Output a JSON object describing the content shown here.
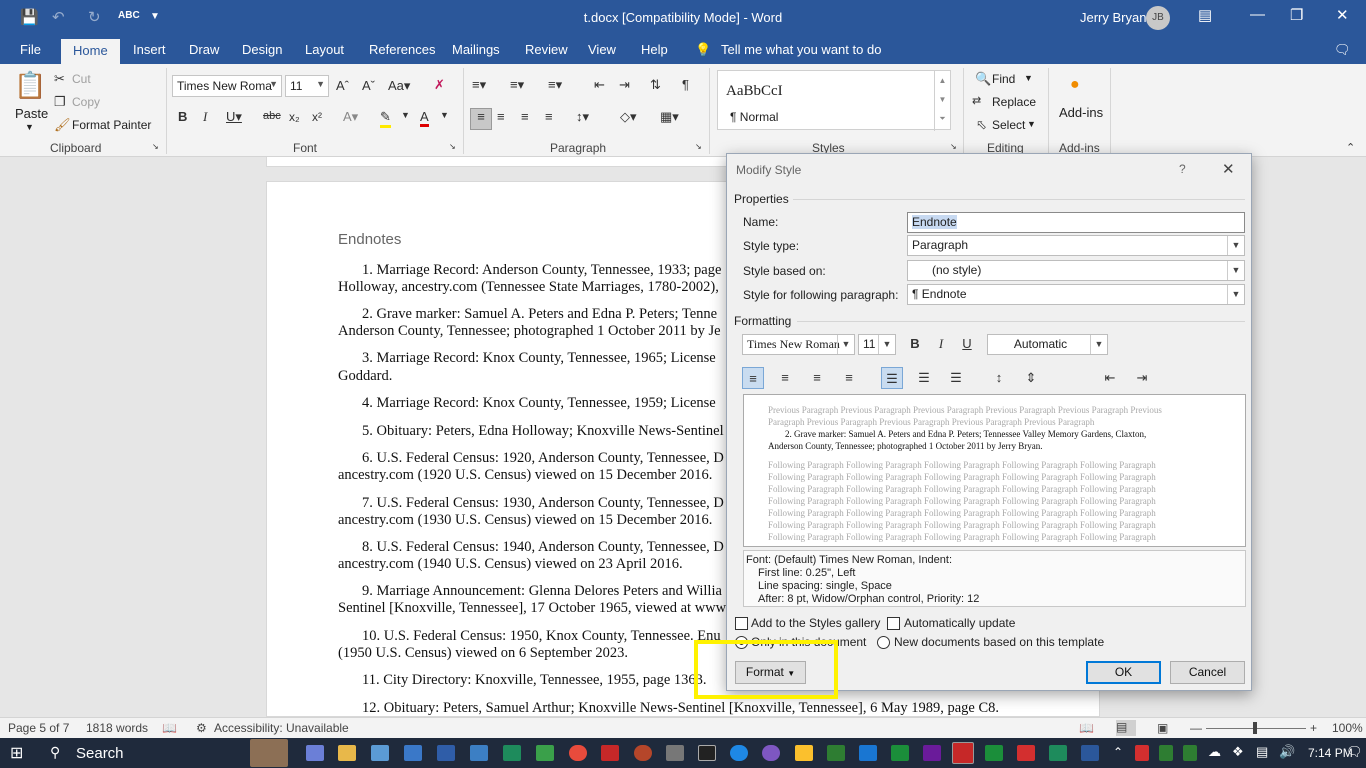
{
  "titlebar": {
    "title": "t.docx [Compatibility Mode]  -  Word",
    "user": "Jerry Bryan",
    "avatar_initials": "JB"
  },
  "tabs": [
    "File",
    "Home",
    "Insert",
    "Draw",
    "Design",
    "Layout",
    "References",
    "Mailings",
    "Review",
    "View",
    "Help"
  ],
  "tell_me": "Tell me what you want to do",
  "ribbon": {
    "clipboard": {
      "paste": "Paste",
      "cut": "Cut",
      "copy": "Copy",
      "format_painter": "Format Painter",
      "label": "Clipboard"
    },
    "font": {
      "name": "Times New Roma",
      "size": "11",
      "label": "Font"
    },
    "paragraph": {
      "label": "Paragraph"
    },
    "styles": {
      "sample": "AaBbCcI",
      "normal": "¶ Normal",
      "label": "Styles"
    },
    "editing": {
      "find": "Find",
      "replace": "Replace",
      "select": "Select",
      "label": "Editing"
    },
    "addins": {
      "button": "Add-ins",
      "label": "Add-ins"
    }
  },
  "document": {
    "heading": "Endnotes",
    "lines": [
      "1. Marriage Record: Anderson County, Tennessee, 1933; page",
      "Holloway, ancestry.com (Tennessee State Marriages, 1780-2002),",
      "2. Grave marker: Samuel A. Peters and Edna P. Peters; Tenne",
      "Anderson County, Tennessee; photographed 1 October 2011 by Je",
      "3. Marriage Record: Knox County, Tennessee, 1965; License",
      "Goddard.",
      "4. Marriage Record: Knox County, Tennessee, 1959; License",
      "5. Obituary: Peters, Edna Holloway; Knoxville News-Sentinel",
      "6. U.S. Federal Census: 1920, Anderson County, Tennessee, D",
      "ancestry.com (1920 U.S. Census) viewed on 15 December 2016.",
      "7. U.S. Federal Census: 1930, Anderson County, Tennessee, D",
      "ancestry.com (1930 U.S. Census) viewed on 15 December 2016.",
      "8. U.S. Federal Census: 1940, Anderson County, Tennessee, D",
      "ancestry.com (1940 U.S. Census) viewed on 23 April 2016.",
      "9. Marriage Announcement: Glenna Delores Peters and Willia",
      "Sentinel [Knoxville, Tennessee], 17 October 1965, viewed at www",
      "10. U.S. Federal Census: 1950, Knox County, Tennessee. Enu",
      "(1950 U.S. Census) viewed on 6 September 2023.",
      "11. City Directory: Knoxville, Tennessee, 1955, page 1363.",
      "12. Obituary: Peters, Samuel Arthur; Knoxville News-Sentinel [Knoxville, Tennessee], 6 May 1989, page C8."
    ]
  },
  "status": {
    "page": "Page 5 of 7",
    "words": "1818 words",
    "accessibility": "Accessibility: Unavailable",
    "zoom": "100%"
  },
  "taskbar": {
    "search": "Search",
    "time": "7:14 PM"
  },
  "dialog": {
    "title": "Modify Style",
    "help": "?",
    "properties": "Properties",
    "name_label": "Name:",
    "name_value": "Endnote",
    "style_type_label": "Style type:",
    "style_type_value": "Paragraph",
    "based_on_label": "Style based on:",
    "based_on_value": "(no style)",
    "following_label": "Style for following paragraph:",
    "following_value": "¶  Endnote",
    "formatting": "Formatting",
    "font_name": "Times New Roman",
    "font_size": "11",
    "color": "Automatic",
    "preview": {
      "prev1": "Previous Paragraph Previous Paragraph Previous Paragraph Previous Paragraph Previous Paragraph Previous",
      "prev2": "Paragraph Previous Paragraph Previous Paragraph Previous Paragraph Previous Paragraph",
      "cur1": "2. Grave marker: Samuel A. Peters and Edna P. Peters; Tennessee Valley Memory Gardens, Claxton,",
      "cur2": "Anderson County, Tennessee; photographed 1 October 2011 by Jerry Bryan.",
      "following": "Following Paragraph Following Paragraph Following Paragraph Following Paragraph Following Paragraph"
    },
    "description": {
      "l1": "Font: (Default) Times New Roman, Indent:",
      "l2": "First line:  0.25\", Left",
      "l3": "Line spacing:  single, Space",
      "l4": "After:  8 pt, Widow/Orphan control, Priority: 12"
    },
    "add_gallery": "Add to the Styles gallery",
    "auto_update": "Automatically update",
    "only_doc": "Only in this document",
    "new_docs": "New documents based on this template",
    "format_btn": "Format",
    "ok": "OK",
    "cancel": "Cancel"
  }
}
